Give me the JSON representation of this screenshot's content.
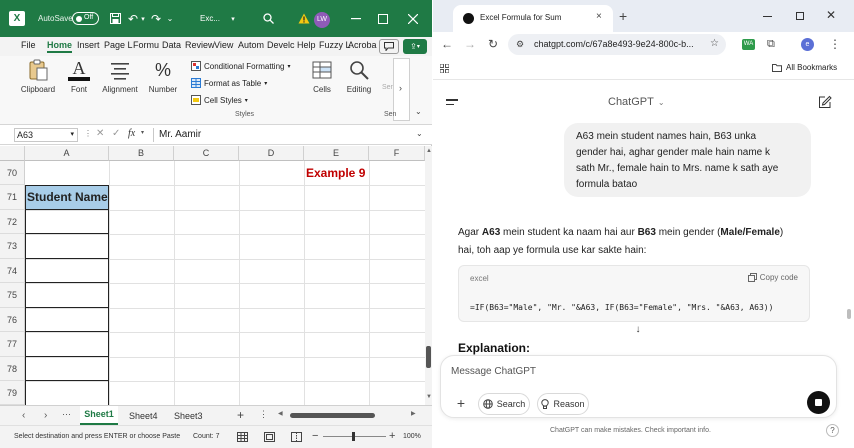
{
  "excel": {
    "title": {
      "autosave_label": "AutoSave",
      "autosave_state": "Off",
      "file_name": "Exc...",
      "user_initials": "LW"
    },
    "tabs": [
      "File",
      "Home",
      "Insert",
      "Page L",
      "Formu",
      "Data",
      "Review",
      "View",
      "Autom",
      "Develc",
      "Help",
      "Fuzzy L",
      "Acroba"
    ],
    "ribbon": {
      "clipboard": "Clipboard",
      "font": "Font",
      "alignment": "Alignment",
      "number": "Number",
      "conditional_formatting": "Conditional Formatting",
      "format_as_table": "Format as Table",
      "cell_styles": "Cell Styles",
      "styles_group": "Styles",
      "cells": "Cells",
      "editing": "Editing",
      "sens_short": "Sen",
      "sens_group_short": "Sen"
    },
    "formula_bar": {
      "name_box": "A63",
      "fx": "fx",
      "value": "Mr. Aamir"
    },
    "columns": [
      "A",
      "B",
      "C",
      "D",
      "E",
      "F"
    ],
    "rows": [
      "70",
      "71",
      "72",
      "73",
      "74",
      "75",
      "76",
      "77",
      "78",
      "79"
    ],
    "cells": {
      "example_label": "Example 9",
      "header_cell": "Student Name"
    },
    "sheets": [
      "Sheet1",
      "Sheet4",
      "Sheet3"
    ],
    "active_sheet": "Sheet1",
    "status": {
      "message": "Select destination and press ENTER or choose Paste",
      "count": "Count: 7",
      "zoom": "100%"
    },
    "colors": {
      "title_bar": "#1f7a45",
      "header_fill": "#a8cde8",
      "example_text": "#c00000"
    }
  },
  "chrome": {
    "tab_title": "Excel Formula for Sum",
    "url": "chatgpt.com/c/67a8e493-9e24-800c-b...",
    "bookmarks_label": "All Bookmarks",
    "profile_initial": "e",
    "ext_label": "WA",
    "chat": {
      "model": "ChatGPT",
      "user_message": [
        "A63 mein student names hain, B63 unka",
        "gender hai, aghar gender male hain name k",
        "sath Mr., female hain to Mrs. name k sath aye",
        "formula batao"
      ],
      "reply_intro_1": {
        "pre": "Agar ",
        "a": "A63",
        "mid": " mein student ka naam hai aur ",
        "b": "B63",
        "mid2": " mein gender (",
        "c": "Male/Female",
        "post": ")"
      },
      "reply_intro_2": "hai, toh aap ye formula use kar sakte hain:",
      "code_lang": "excel",
      "copy_label": "Copy code",
      "code": "=IF(B63=\"Male\", \"Mr. \"&A63, IF(B63=\"Female\", \"Mrs. \"&A63, A63))",
      "explanation": "Explanation:",
      "input_placeholder": "Message ChatGPT",
      "search_label": "Search",
      "reason_label": "Reason",
      "disclaimer": "ChatGPT can make mistakes. Check important info."
    }
  }
}
